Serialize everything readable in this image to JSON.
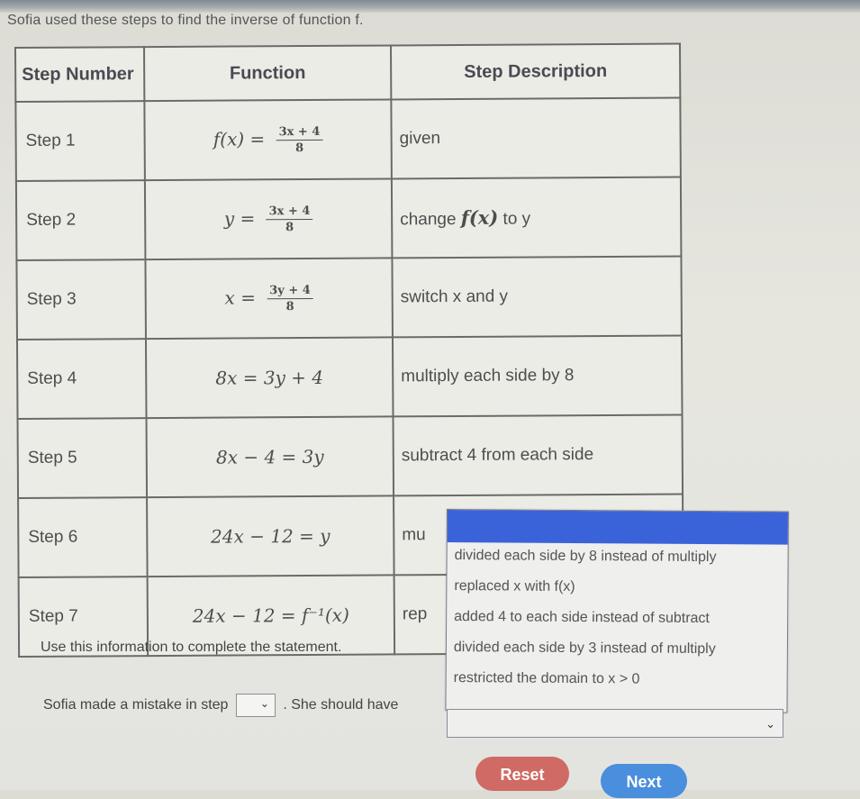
{
  "intro": "Sofia used these steps to find the inverse of function f.",
  "table": {
    "headers": [
      "Step Number",
      "Function",
      "Step Description"
    ],
    "rows": [
      {
        "step": "Step 1",
        "lhs": "f(x) =",
        "num": "3x + 4",
        "den": "8",
        "expr": "",
        "desc": "given"
      },
      {
        "step": "Step 2",
        "lhs": "y =",
        "num": "3x + 4",
        "den": "8",
        "expr": "",
        "desc_pre": "change",
        "desc_fx": "f(x)",
        "desc_post": "to y"
      },
      {
        "step": "Step 3",
        "lhs": "x =",
        "num": "3y + 4",
        "den": "8",
        "expr": "",
        "desc": "switch x and y"
      },
      {
        "step": "Step 4",
        "expr": "8x = 3y + 4",
        "desc": "multiply each side by 8"
      },
      {
        "step": "Step 5",
        "expr": "8x − 4 = 3y",
        "desc": "subtract 4 from each side"
      },
      {
        "step": "Step 6",
        "expr": "24x − 12 = y",
        "desc": "mu"
      },
      {
        "step": "Step 7",
        "expr": "24x − 12 = f⁻¹(x)",
        "desc": "rep"
      }
    ]
  },
  "statement": {
    "instruction": "Use this information to complete the statement.",
    "prefix": "Sofia made a mistake in step",
    "middle": ". She should have",
    "step_select_value": "",
    "should_select_value": ""
  },
  "dropdown": {
    "options": [
      "divided each side by 8 instead of multiply",
      "replaced x with f(x)",
      "added 4 to each side instead of subtract",
      "divided each side by 3 instead of multiply",
      "restricted the domain to x > 0"
    ],
    "highlight_color": "#3b63d9"
  },
  "buttons": {
    "reset": "Reset",
    "next": "Next"
  },
  "icons": {
    "chevron": "⌄"
  }
}
